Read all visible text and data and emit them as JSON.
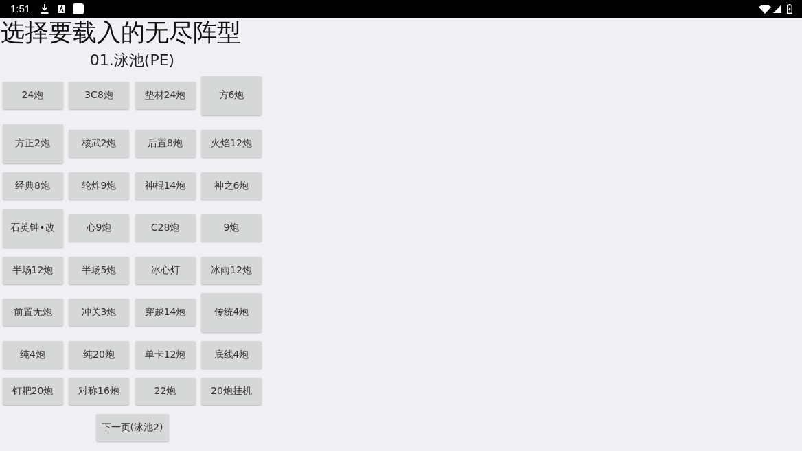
{
  "status_bar": {
    "time": "1:51"
  },
  "title": "选择要载入的无尽阵型",
  "subtitle": "01.泳池(PE)",
  "rows": [
    {
      "buttons": [
        {
          "label": "24炮",
          "tall": false
        },
        {
          "label": "3C8炮",
          "tall": false
        },
        {
          "label": "垫材24炮",
          "tall": false
        },
        {
          "label": "方6炮",
          "tall": true
        }
      ]
    },
    {
      "buttons": [
        {
          "label": "方正2炮",
          "tall": true
        },
        {
          "label": "核武2炮",
          "tall": false
        },
        {
          "label": "后置8炮",
          "tall": false
        },
        {
          "label": "火焰12炮",
          "tall": false
        }
      ]
    },
    {
      "buttons": [
        {
          "label": "经典8炮",
          "tall": false
        },
        {
          "label": "轮炸9炮",
          "tall": false
        },
        {
          "label": "神棍14炮",
          "tall": false
        },
        {
          "label": "神之6炮",
          "tall": false
        }
      ]
    },
    {
      "buttons": [
        {
          "label": "石英钟•改",
          "tall": true
        },
        {
          "label": "心9炮",
          "tall": false
        },
        {
          "label": "C28炮",
          "tall": false
        },
        {
          "label": "9炮",
          "tall": false
        }
      ]
    },
    {
      "buttons": [
        {
          "label": "半场12炮",
          "tall": false
        },
        {
          "label": "半场5炮",
          "tall": false
        },
        {
          "label": "冰心灯",
          "tall": false
        },
        {
          "label": "冰雨12炮",
          "tall": false
        }
      ]
    },
    {
      "buttons": [
        {
          "label": "前置无炮",
          "tall": false
        },
        {
          "label": "冲关3炮",
          "tall": false
        },
        {
          "label": "穿越14炮",
          "tall": false
        },
        {
          "label": "传统4炮",
          "tall": true
        }
      ]
    },
    {
      "buttons": [
        {
          "label": "纯4炮",
          "tall": false
        },
        {
          "label": "纯20炮",
          "tall": false
        },
        {
          "label": "单卡12炮",
          "tall": false
        },
        {
          "label": "底线4炮",
          "tall": false
        }
      ]
    },
    {
      "buttons": [
        {
          "label": "钉耙20炮",
          "tall": false
        },
        {
          "label": "对称16炮",
          "tall": false
        },
        {
          "label": "22炮",
          "tall": false
        },
        {
          "label": "20炮挂机",
          "tall": false
        }
      ]
    }
  ],
  "next_button": {
    "label": "下一页(泳池2)"
  }
}
